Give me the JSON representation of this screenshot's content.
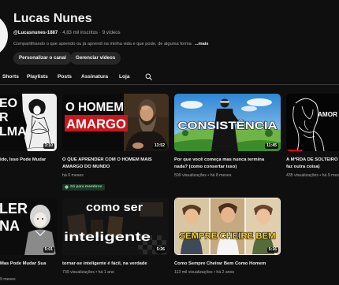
{
  "channel": {
    "name": "Lucas Nunes",
    "handle": "@Lucasnunes-1887",
    "separator": "·",
    "subscribers": "4,83 mil inscritos",
    "video_count": "9 vídeos",
    "description": "Compartilhando o que aprendo ou já aprendi na minha vida e que pode, de alguma forma",
    "more": "...mais",
    "buttons": {
      "customize": "Personalizar o canal",
      "manage": "Gerenciar vídeos"
    }
  },
  "tabs": [
    "Shorts",
    "Playlists",
    "Posts",
    "Assinatura",
    "Loja"
  ],
  "search_icon": "search-icon",
  "videos": [
    {
      "title_lines": [
        "ido, Isso Pode Mudar"
      ],
      "duration": "3:10",
      "thumb_text": [
        "EO",
        "R",
        "LMA"
      ]
    },
    {
      "title_lines": [
        "O QUE APRENDER COM O HOMEM MAIS",
        "AMARGO DO MUNDO"
      ],
      "meta": "há 6 meses",
      "badge": "Só para membros",
      "duration": "13:52",
      "thumb_text": [
        "O HOMEM",
        "AMARGO"
      ]
    },
    {
      "title_lines": [
        "Por que você começa mas nunca termina",
        "nada? (como consertar isso)"
      ],
      "meta": "599 visualizações • há 8 meses",
      "duration": "11:45",
      "thumb_text": [
        "CONSISTÊNCIA"
      ]
    },
    {
      "title_lines": [
        "A M*RDA DE SOLTEIRO (O",
        "faz outra coisa)"
      ],
      "meta": "435 visualizações • há 9 meses",
      "thumb_text": [
        "AMOR"
      ],
      "watch_progress": 0.15
    },
    {
      "title_lines": [
        "Mas Pode Mudar Sua"
      ],
      "meta": "9 meses",
      "duration": "5:01",
      "thumb_text": [
        "LER",
        "NA"
      ]
    },
    {
      "title_lines": [
        "tornar-se inteligente é fácil, na verdade"
      ],
      "meta": "739 visualizações • há 1 ano",
      "duration": "5:26",
      "thumb_text": [
        "como ser",
        "inteligente"
      ]
    },
    {
      "title_lines": [
        "Como Sempre Cheirar Bem Como Homem"
      ],
      "meta": "113 mil visualizações • há 2 anos",
      "duration": "5:16",
      "thumb_text": [
        "SEMPRE CHEIRE BEM"
      ]
    }
  ],
  "colors": {
    "background": "#0f0f0f",
    "text": "#f1f1f1",
    "secondary_text": "#aaaaaa",
    "button_bg": "#272727",
    "watch_progress": "#ff0000",
    "members_badge_text": "#8fd6a6"
  }
}
